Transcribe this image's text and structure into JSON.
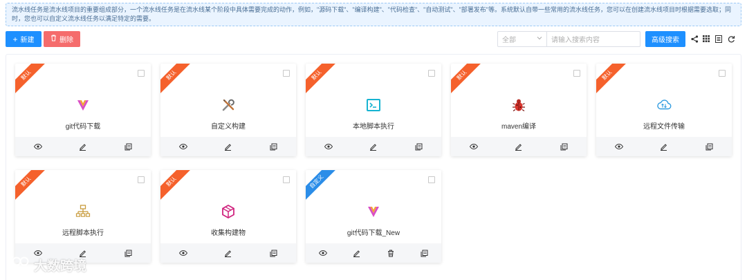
{
  "notice": "流水线任务是流水线项目的重要组成部分，一个流水线任务是在流水线某个阶段中具体需要完成的动作，例如，\"源码下载\"、\"编译构建\"、\"代码检查\"、\"自动测试\"、\"部署发布\"等。系统默认自带一些常用的流水线任务，您可以在创建流水线项目时根据需要选取；同时，您也可以自定义流水线任务以满足特定的需要。",
  "toolbar": {
    "new_label": "新建",
    "delete_label": "删除",
    "select_value": "全部",
    "search_placeholder": "请输入搜索内容",
    "advanced_search_label": "高级搜索"
  },
  "cards": [
    {
      "ribbon": "默认",
      "label": "git代码下载",
      "icon": "vue-v-icon"
    },
    {
      "ribbon": "默认",
      "label": "自定义构建",
      "icon": "tools-icon"
    },
    {
      "ribbon": "默认",
      "label": "本地脚本执行",
      "icon": "terminal-icon"
    },
    {
      "ribbon": "默认",
      "label": "maven编译",
      "icon": "bug-icon"
    },
    {
      "ribbon": "默认",
      "label": "远程文件传输",
      "icon": "cloud-transfer-icon"
    },
    {
      "ribbon": "默认",
      "label": "远程脚本执行",
      "icon": "network-tree-icon"
    },
    {
      "ribbon": "默认",
      "label": "收集构建物",
      "icon": "package-box-icon"
    },
    {
      "ribbon": "自定义",
      "label": "git代码下载_New",
      "icon": "vue-v-icon"
    }
  ],
  "watermark": "大数跨境",
  "colors": {
    "primary": "#1e90ff",
    "danger": "#f56c6c",
    "ribbon_default": "#f5612c",
    "ribbon_custom": "#2b8de8"
  }
}
